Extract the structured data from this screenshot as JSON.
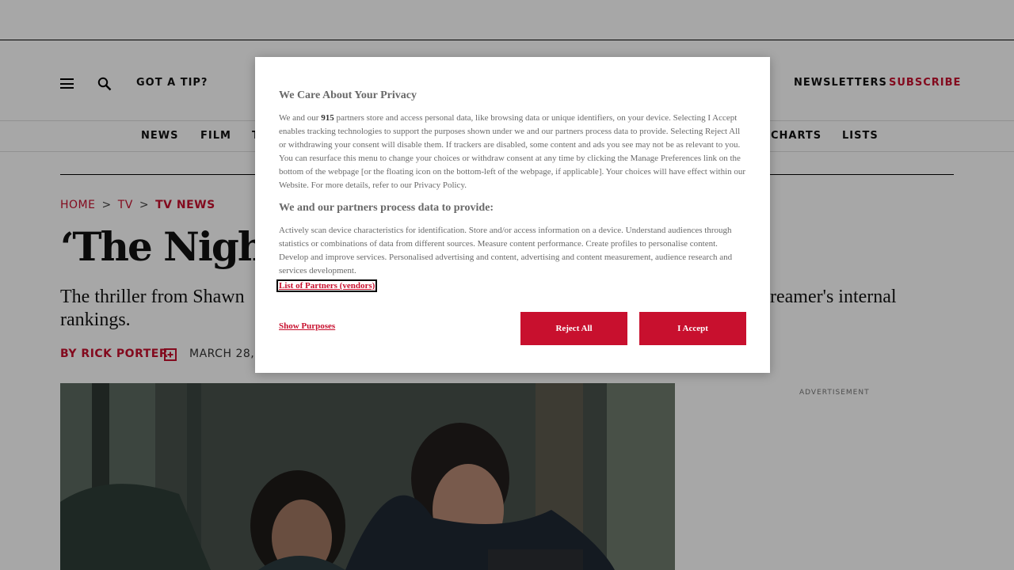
{
  "header": {
    "tip_label": "GOT A TIP?",
    "newsletters_label": "NEWSLETTERS",
    "subscribe_label": "SUBSCRIBE"
  },
  "nav": {
    "items": [
      "NEWS",
      "FILM",
      "T",
      "CHARTS",
      "LISTS"
    ]
  },
  "breadcrumb": {
    "home": "HOME",
    "tv": "TV",
    "current": "TV NEWS",
    "separator": ">"
  },
  "article": {
    "headline": "‘The Night A",
    "dek": "The thriller from Shawn                                                                                    streamer's internal rankings.",
    "dek_left": "The thriller from Shawn",
    "dek_right": "streamer's internal",
    "dek_line2": "rankings.",
    "byline": "BY RICK PORTER",
    "date": "MARCH 28,"
  },
  "sidebar": {
    "ad_label": "ADVERTISEMENT"
  },
  "consent": {
    "title": "We Care About Your Privacy",
    "intro_before_count": "We and our",
    "partner_count": "915",
    "intro_after_count": "partners store and access personal data, like browsing data or unique identifiers, on your device. Selecting I Accept enables tracking technologies to support the purposes shown under we and our partners process data to provide. Selecting Reject All or withdrawing your consent will disable them. If trackers are disabled, some content and ads you see may not be as relevant to you. You can resurface this menu to change your choices or withdraw consent at any time by clicking the Manage Preferences link on the bottom of the webpage [or the floating icon on the bottom-left of the webpage, if applicable]. Your choices will have effect within our Website. For more details, refer to our Privacy Policy.",
    "purposes_title": "We and our partners process data to provide:",
    "purposes_text": "Actively scan device characteristics for identification. Store and/or access information on a device. Understand audiences through statistics or combinations of data from different sources. Measure content performance. Create profiles to personalise content. Develop and improve services. Personalised advertising and content, advertising and content measurement, audience research and services development.",
    "vendors_link": "List of Partners (vendors)",
    "show_purposes": "Show Purposes",
    "reject_label": "Reject All",
    "accept_label": "I Accept"
  },
  "colors": {
    "brand_red": "#c8102e",
    "overlay": "rgba(0,0,0,0.345)"
  }
}
